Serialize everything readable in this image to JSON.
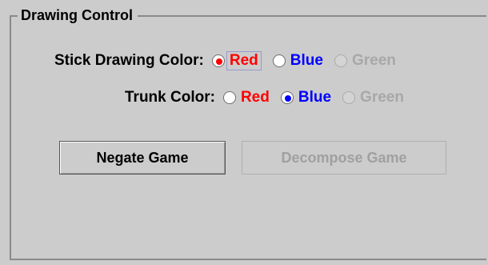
{
  "panel": {
    "title": "Drawing Control"
  },
  "stick_color": {
    "label": "Stick Drawing Color:",
    "options": [
      {
        "label": "Red",
        "selected": true,
        "enabled": true,
        "color": "#ff0000"
      },
      {
        "label": "Blue",
        "selected": false,
        "enabled": true,
        "color": "#0000ff"
      },
      {
        "label": "Green",
        "selected": false,
        "enabled": false,
        "color": "#a8a8a8"
      }
    ]
  },
  "trunk_color": {
    "label": "Trunk Color:",
    "options": [
      {
        "label": "Red",
        "selected": false,
        "enabled": true,
        "color": "#ff0000"
      },
      {
        "label": "Blue",
        "selected": true,
        "enabled": true,
        "color": "#0000ff"
      },
      {
        "label": "Green",
        "selected": false,
        "enabled": false,
        "color": "#a8a8a8"
      }
    ]
  },
  "buttons": {
    "negate_label": "Negate Game",
    "decompose_label": "Decompose Game",
    "decompose_enabled": false
  }
}
